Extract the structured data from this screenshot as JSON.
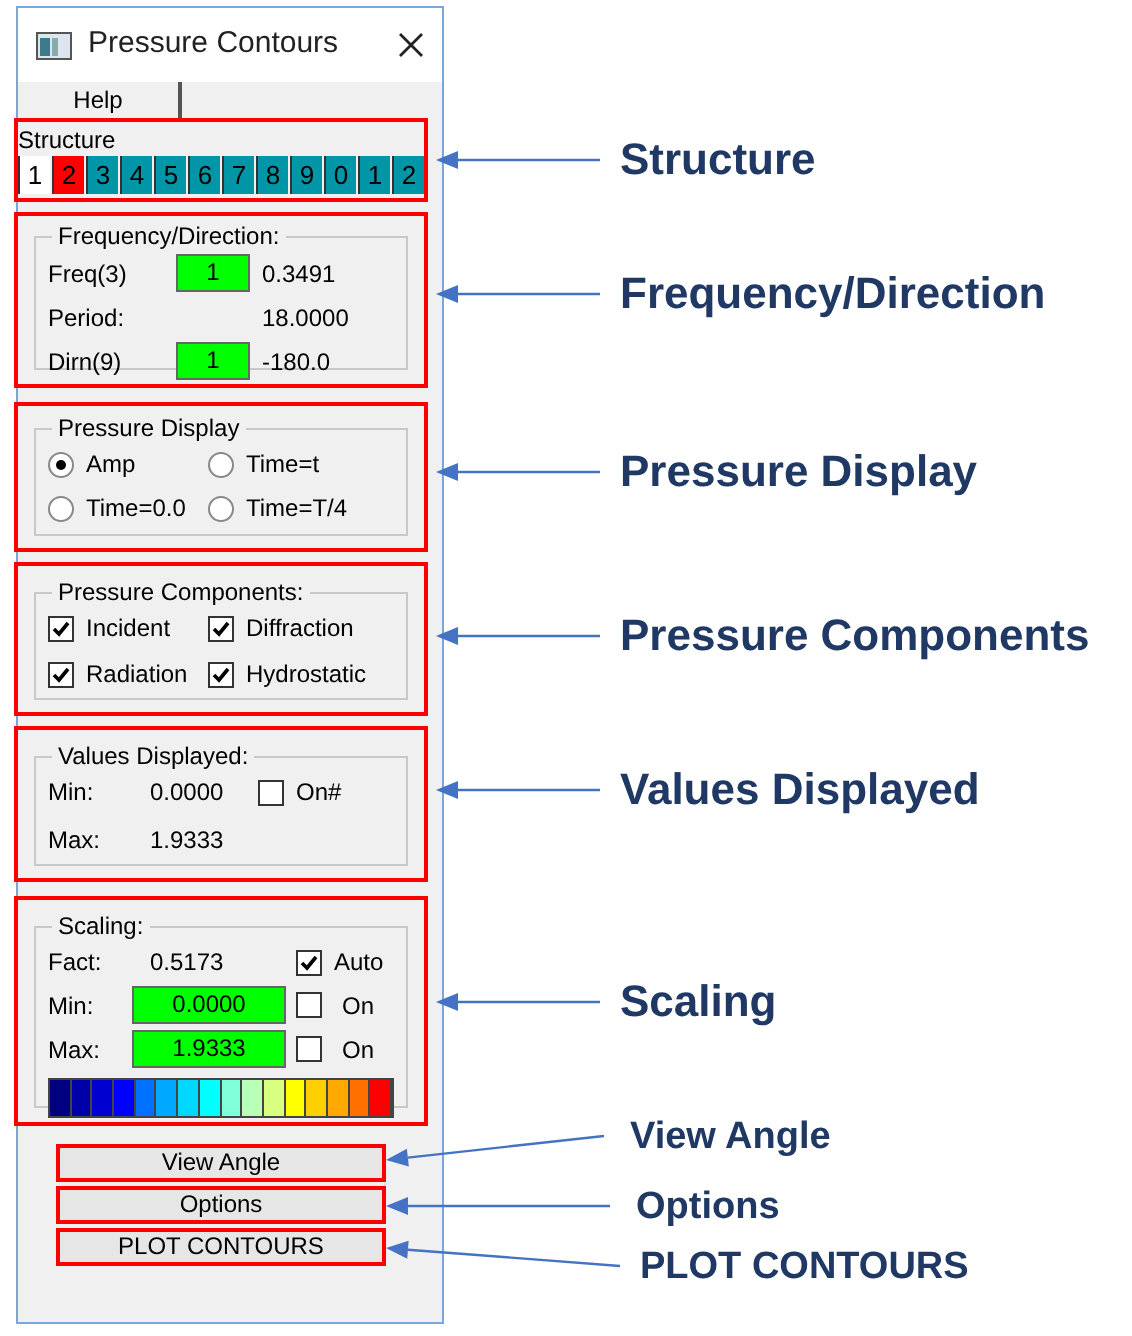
{
  "dialog": {
    "title": "Pressure Contours",
    "menu": [
      "Help"
    ],
    "structure": {
      "label": "Structure",
      "tabs": [
        {
          "label": "1",
          "color": "#ffffff"
        },
        {
          "label": "2",
          "color": "#ff0000"
        },
        {
          "label": "3",
          "color": "#0096a8"
        },
        {
          "label": "4",
          "color": "#0096a8"
        },
        {
          "label": "5",
          "color": "#0096a8"
        },
        {
          "label": "6",
          "color": "#0096a8"
        },
        {
          "label": "7",
          "color": "#0096a8"
        },
        {
          "label": "8",
          "color": "#0096a8"
        },
        {
          "label": "9",
          "color": "#0096a8"
        },
        {
          "label": "0",
          "color": "#0096a8"
        },
        {
          "label": "1",
          "color": "#0096a8"
        },
        {
          "label": "2",
          "color": "#0096a8"
        }
      ]
    },
    "frequency_direction": {
      "title": "Frequency/Direction:",
      "rows": [
        {
          "label": "Freq(3)",
          "index": "1",
          "value": "0.3491"
        },
        {
          "label": "Period:",
          "value": "18.0000"
        },
        {
          "label": "Dirn(9)",
          "index": "1",
          "value": "-180.0"
        }
      ]
    },
    "pressure_display": {
      "title": "Pressure Display",
      "options": [
        {
          "label": "Amp",
          "selected": true
        },
        {
          "label": "Time=t",
          "selected": false
        },
        {
          "label": "Time=0.0",
          "selected": false
        },
        {
          "label": "Time=T/4",
          "selected": false
        }
      ]
    },
    "pressure_components": {
      "title": "Pressure Components:",
      "items": [
        {
          "label": "Incident",
          "checked": true
        },
        {
          "label": "Diffraction",
          "checked": true
        },
        {
          "label": "Radiation",
          "checked": true
        },
        {
          "label": "Hydrostatic",
          "checked": true
        }
      ]
    },
    "values_displayed": {
      "title": "Values Displayed:",
      "min_label": "Min:",
      "min": "0.0000",
      "max_label": "Max:",
      "max": "1.9333",
      "on_label": "On#",
      "on_checked": false
    },
    "scaling": {
      "title": "Scaling:",
      "fact_label": "Fact:",
      "fact": "0.5173",
      "auto_label": "Auto",
      "auto_checked": true,
      "rows": [
        {
          "label": "Min:",
          "value": "0.0000",
          "on_label": "On",
          "checked": false
        },
        {
          "label": "Max:",
          "value": "1.9333",
          "on_label": "On",
          "checked": false
        }
      ],
      "legend": [
        {
          "color": "#000080"
        },
        {
          "color": "#0000a8"
        },
        {
          "color": "#0000d0"
        },
        {
          "color": "#0000ff"
        },
        {
          "color": "#0070ff"
        },
        {
          "color": "#00a8ff"
        },
        {
          "color": "#00d8ff"
        },
        {
          "color": "#00ffff"
        },
        {
          "color": "#80ffd8"
        },
        {
          "color": "#b8ffb8"
        },
        {
          "color": "#d8ff80"
        },
        {
          "color": "#ffff00"
        },
        {
          "color": "#ffd000"
        },
        {
          "color": "#ffa800"
        },
        {
          "color": "#ff7000"
        },
        {
          "color": "#ff0000"
        }
      ]
    },
    "buttons": [
      "View Angle",
      "Options",
      "PLOT CONTOURS"
    ]
  },
  "callouts": [
    "Structure",
    "Frequency/Direction",
    "Pressure Display",
    "Pressure Components",
    "Values Displayed",
    "Scaling",
    "View Angle",
    "Options",
    "PLOT CONTOURS"
  ]
}
